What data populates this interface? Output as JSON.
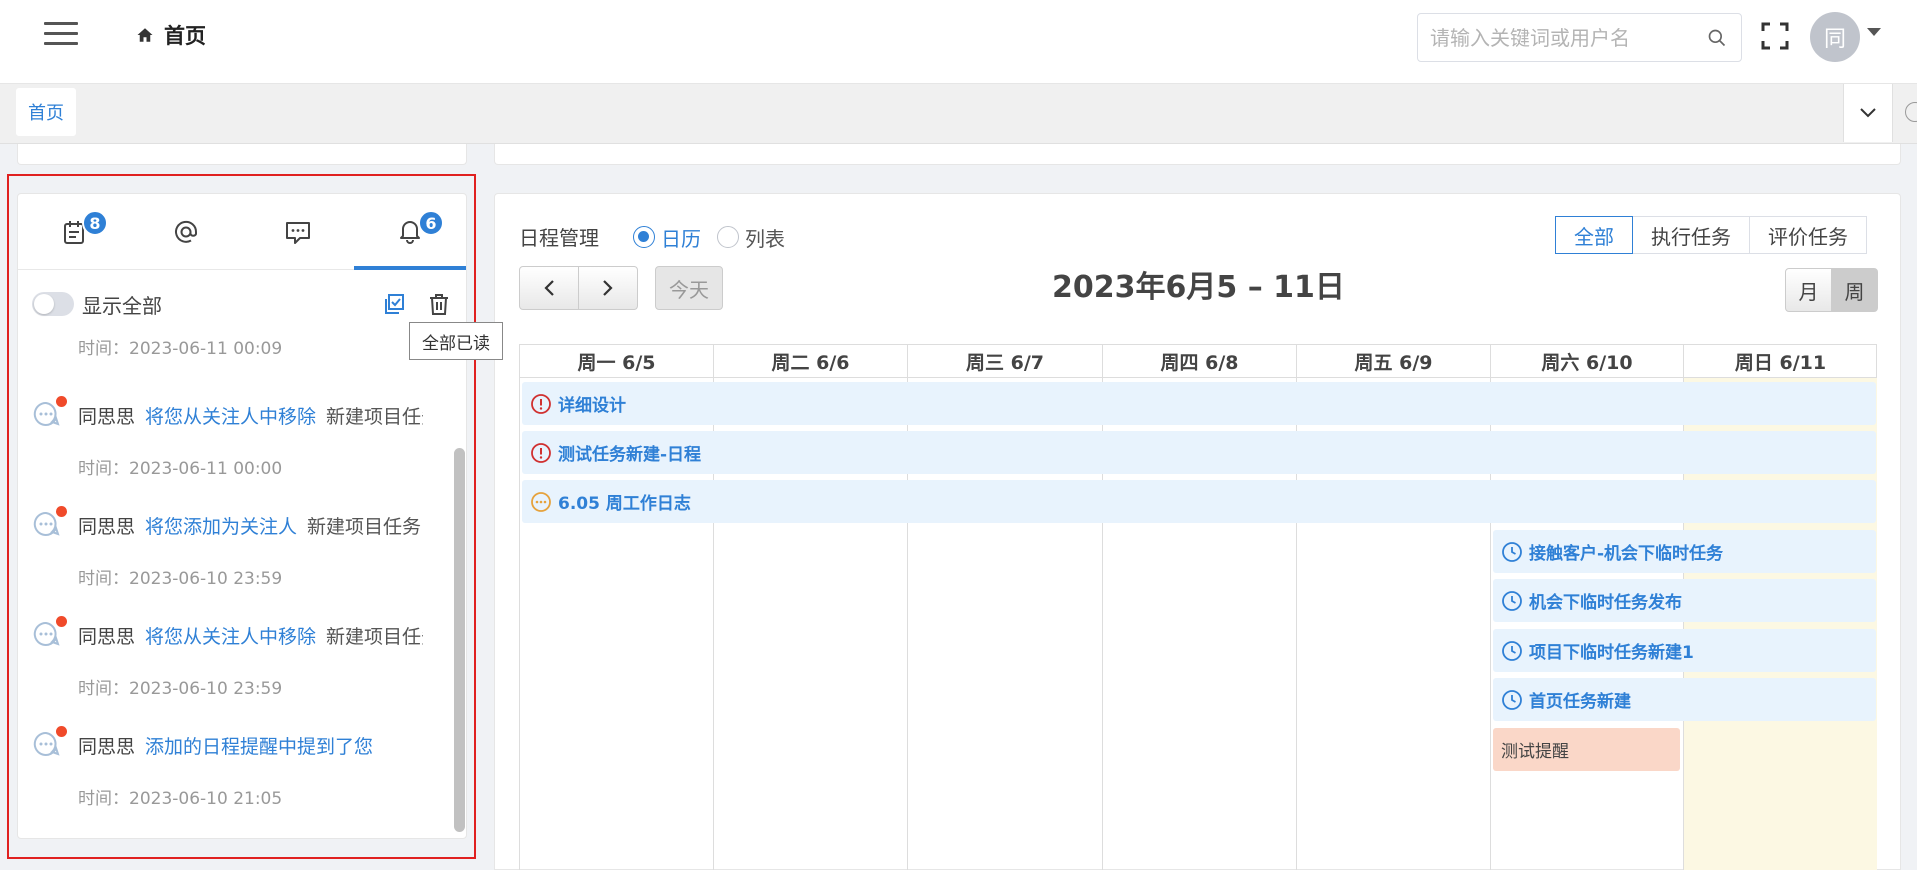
{
  "header": {
    "breadcrumb": "首页",
    "search_placeholder": "请输入关键词或用户名",
    "avatar_text": "同"
  },
  "tabs": {
    "home": "首页"
  },
  "notice_panel": {
    "tabs": [
      {
        "icon": "calendar-icon",
        "badge": "8"
      },
      {
        "icon": "at-icon",
        "badge": ""
      },
      {
        "icon": "message-icon",
        "badge": ""
      },
      {
        "icon": "bell-icon",
        "badge": "6"
      }
    ],
    "toggle_label": "显示全部",
    "tooltip": "全部已读",
    "first_time": "时间：2023-06-11 00:09",
    "items": [
      {
        "sender": "同思思",
        "action": "将您从关注人中移除",
        "subject": "新建项目任务",
        "time": "时间：2023-06-11 00:00"
      },
      {
        "sender": "同思思",
        "action": "将您添加为关注人",
        "subject": "新建项目任务",
        "time": "时间：2023-06-10 23:59"
      },
      {
        "sender": "同思思",
        "action": "将您从关注人中移除",
        "subject": "新建项目任务",
        "time": "时间：2023-06-10 23:59"
      },
      {
        "sender": "同思思",
        "action": "添加的日程提醒中提到了您",
        "subject": "",
        "time": "时间：2023-06-10 21:05"
      }
    ]
  },
  "calendar": {
    "title": "日程管理",
    "mode_options": [
      "日历",
      "列表"
    ],
    "mode_selected": "日历",
    "filters": [
      "全部",
      "执行任务",
      "评价任务"
    ],
    "filter_selected": "全部",
    "today_label": "今天",
    "range_title": "2023年6月5 – 11日",
    "views": [
      "月",
      "周"
    ],
    "view_selected": "周",
    "days": [
      "周一 6/5",
      "周二 6/6",
      "周三 6/7",
      "周四 6/8",
      "周五 6/9",
      "周六 6/10",
      "周日 6/11"
    ],
    "events": [
      {
        "title": "详细设计",
        "icon": "alert-circle-icon",
        "color": "#d03030"
      },
      {
        "title": "测试任务新建-日程",
        "icon": "alert-circle-icon",
        "color": "#d03030"
      },
      {
        "title": "6.05 周工作日志",
        "icon": "ellipsis-circle-icon",
        "color": "#e6a23c"
      },
      {
        "title": "接触客户-机会下临时任务",
        "icon": "clock-icon",
        "color": "#2f80d6"
      },
      {
        "title": "机会下临时任务发布",
        "icon": "clock-icon",
        "color": "#2f80d6"
      },
      {
        "title": "项目下临时任务新建1",
        "icon": "clock-icon",
        "color": "#2f80d6"
      },
      {
        "title": "首页任务新建",
        "icon": "clock-icon",
        "color": "#2f80d6"
      },
      {
        "title": "测试提醒",
        "icon": "",
        "color": "#fad7c8"
      }
    ]
  }
}
